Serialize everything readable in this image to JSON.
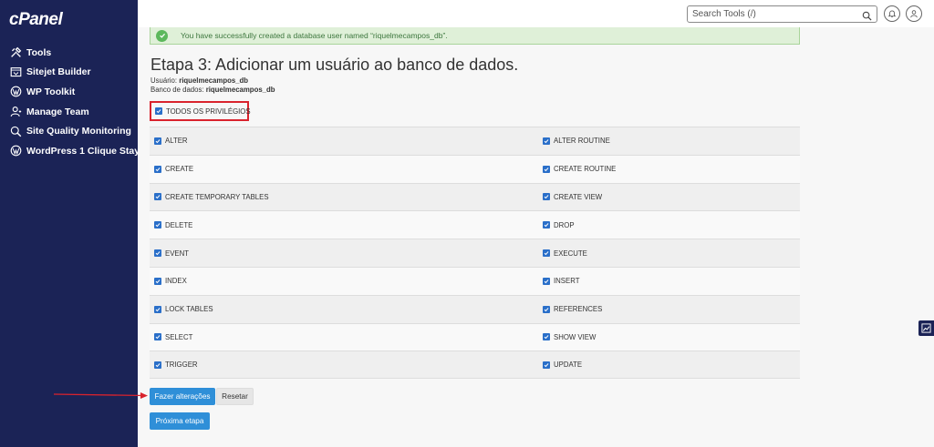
{
  "brand": {
    "logo": "cPanel"
  },
  "sidebar": {
    "items": [
      {
        "label": "Tools",
        "icon": "tools-icon"
      },
      {
        "label": "Sitejet Builder",
        "icon": "sitejet-icon"
      },
      {
        "label": "WP Toolkit",
        "icon": "wordpress-icon"
      },
      {
        "label": "Manage Team",
        "icon": "team-icon"
      },
      {
        "label": "Site Quality Monitoring",
        "icon": "monitoring-icon"
      },
      {
        "label": "WordPress 1 Clique Stay",
        "icon": "wordpress-icon"
      }
    ]
  },
  "header": {
    "search_placeholder": "Search Tools (/)",
    "icons": [
      "search-icon",
      "bell-icon",
      "user-icon"
    ]
  },
  "alert": {
    "text": "You have successfully created a database user named “riquelmecampos_db”."
  },
  "page": {
    "title": "Etapa 3: Adicionar um usuário ao banco de dados.",
    "user_label": "Usuário:",
    "user_value": "riquelmecampos_db",
    "db_label": "Banco de dados:",
    "db_value": "riquelmecampos_db"
  },
  "all_privileges": {
    "label": "TODOS OS PRIVILÉGIOS",
    "checked": true
  },
  "privileges": [
    [
      "ALTER",
      "ALTER ROUTINE"
    ],
    [
      "CREATE",
      "CREATE ROUTINE"
    ],
    [
      "CREATE TEMPORARY TABLES",
      "CREATE VIEW"
    ],
    [
      "DELETE",
      "DROP"
    ],
    [
      "EVENT",
      "EXECUTE"
    ],
    [
      "INDEX",
      "INSERT"
    ],
    [
      "LOCK TABLES",
      "REFERENCES"
    ],
    [
      "SELECT",
      "SHOW VIEW"
    ],
    [
      "TRIGGER",
      "UPDATE"
    ]
  ],
  "buttons": {
    "make_changes": "Fazer alterações",
    "reset": "Resetar",
    "next_step": "Próxima etapa"
  },
  "colors": {
    "sidebar_bg": "#1b2356",
    "primary": "#2f8fd8",
    "checkbox": "#2a6fc9",
    "highlight_border": "#d9232d",
    "arrow": "#d9232d",
    "alert_bg": "#dff0d8"
  }
}
